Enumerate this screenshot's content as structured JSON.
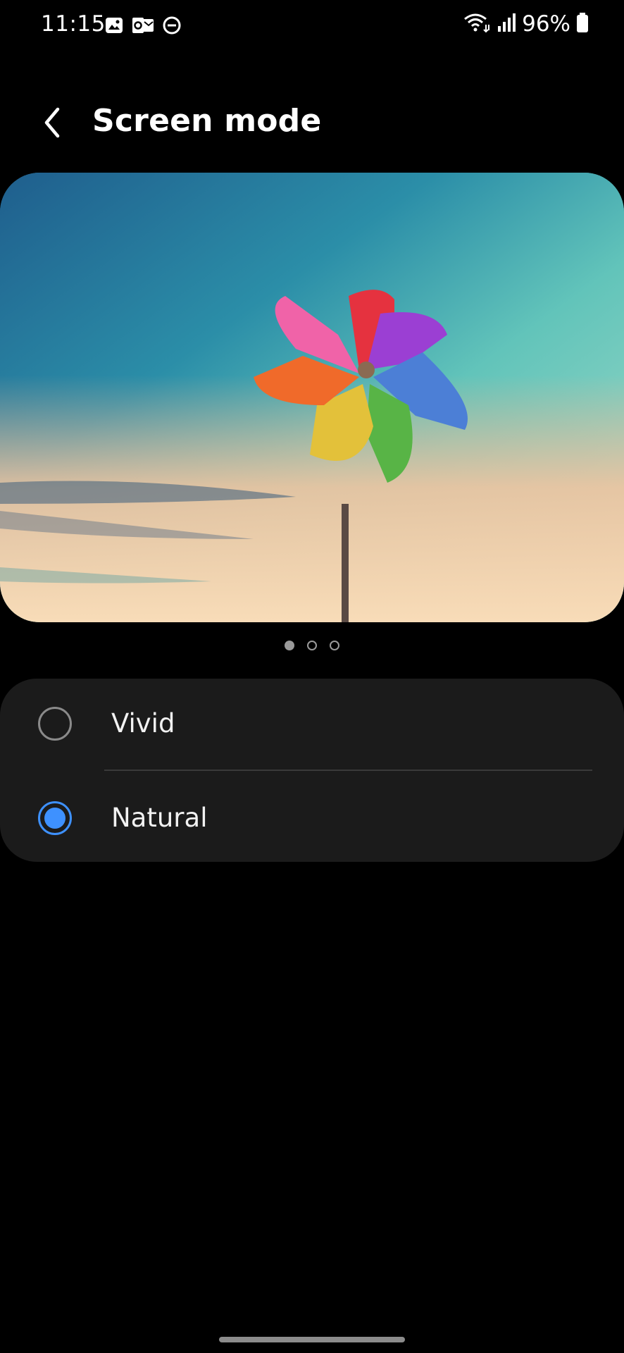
{
  "status_bar": {
    "time": "11:15",
    "left_icons": [
      "gallery-icon",
      "outlook-icon",
      "do-not-disturb-icon"
    ],
    "right_icons": [
      "wifi-icon",
      "signal-icon",
      "battery-icon"
    ],
    "battery": "96%"
  },
  "header": {
    "back_icon": "chevron-left-icon",
    "title": "Screen mode"
  },
  "preview": {
    "image": "pinwheel-sky-photo",
    "page_count": 3,
    "current_page": 1
  },
  "options": [
    {
      "label": "Vivid",
      "selected": false
    },
    {
      "label": "Natural",
      "selected": true
    }
  ],
  "colors": {
    "background": "#000000",
    "card": "#1b1b1b",
    "accent": "#3e91ff",
    "text": "#ffffff"
  }
}
